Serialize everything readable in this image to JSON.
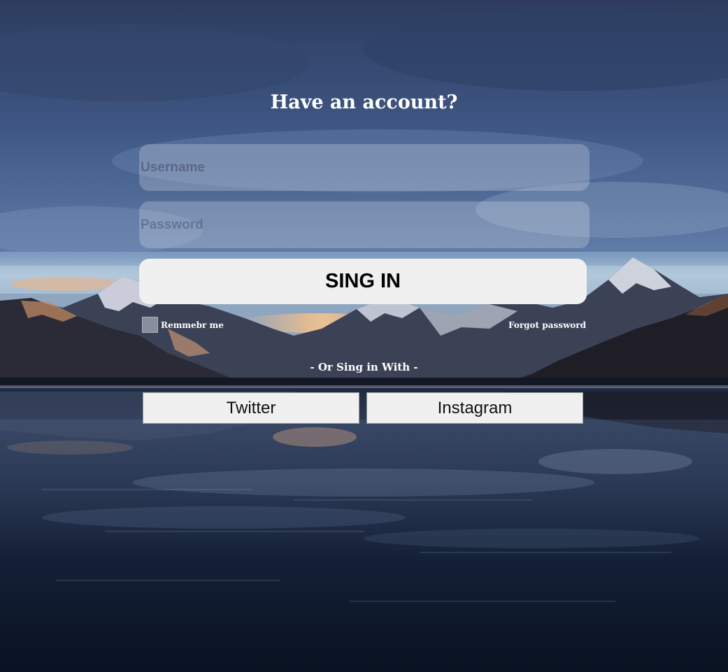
{
  "login": {
    "heading": "Have an account?",
    "username_placeholder": "Username",
    "password_placeholder": "Password",
    "signin_label": "SING IN",
    "remember_label": "Remmebr me",
    "forgot_label": "Forgot password",
    "or_text": "- Or Sing in With -",
    "social": {
      "twitter_label": "Twitter",
      "instagram_label": "Instagram"
    }
  },
  "background": {
    "name": "mountain-lake-scene",
    "colors": {
      "sky_top": "#3a4d74",
      "sky_horizon": "#a9c0d6",
      "mountains": "#2a2c3a",
      "snow": "#d8dce6",
      "water_dark": "#0b1426"
    }
  }
}
